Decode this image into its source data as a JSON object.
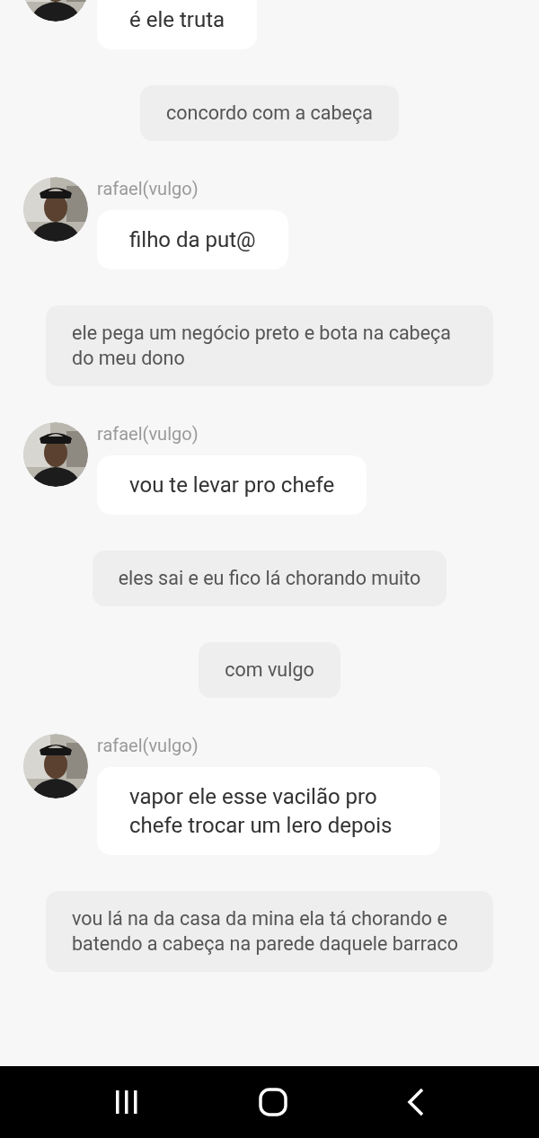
{
  "messages": [
    {
      "kind": "incoming",
      "text": "é ele truta"
    },
    {
      "kind": "narration",
      "text": "concordo com a cabeça"
    },
    {
      "kind": "incoming",
      "name": "rafael(vulgo)",
      "text": "filho da put@"
    },
    {
      "kind": "narration",
      "text": "ele pega um negócio preto e bota na cabeça do meu dono"
    },
    {
      "kind": "incoming",
      "name": "rafael(vulgo)",
      "text": "vou te levar pro chefe"
    },
    {
      "kind": "narration",
      "text": "eles sai e eu fico lá chorando muito"
    },
    {
      "kind": "narration",
      "text": "com vulgo"
    },
    {
      "kind": "incoming",
      "name": "rafael(vulgo)",
      "text": "vapor ele esse vacilão pro chefe trocar um lero depois"
    },
    {
      "kind": "narration",
      "text": "vou lá na da casa da mina ela tá chorando e batendo a cabeça na parede daquele barraco"
    }
  ]
}
